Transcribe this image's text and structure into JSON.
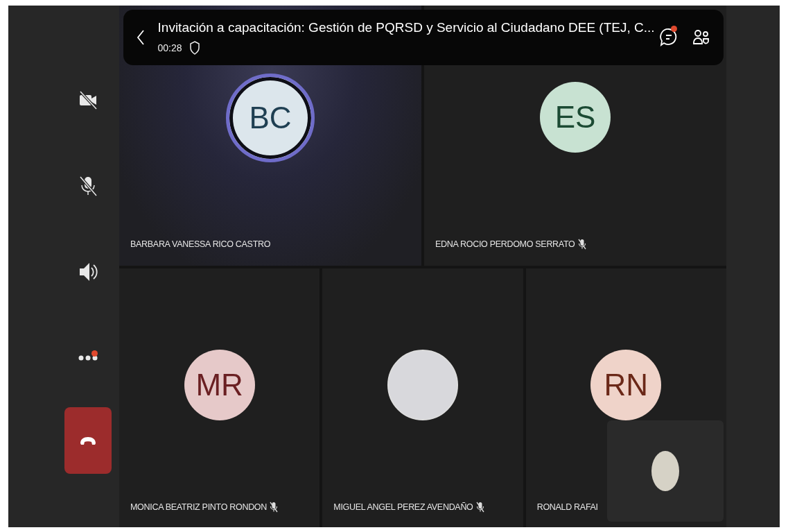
{
  "meeting": {
    "title": "Invitación a capacitación: Gestión de PQRSD y Servicio al Ciudadano DEE (TEJ, C...",
    "elapsed": "00:28",
    "chat_notification": true
  },
  "controls": [
    {
      "kind": "camera_off",
      "notification": false
    },
    {
      "kind": "mic_off",
      "notification": false
    },
    {
      "kind": "speaker",
      "notification": false
    },
    {
      "kind": "more",
      "notification": true
    },
    {
      "kind": "hang_up",
      "notification": false
    }
  ],
  "participants": [
    {
      "name": "BARBARA VANESSA RICO CASTRO",
      "kind": "initials",
      "initials": "BC",
      "color": "#dce6ec",
      "muted": false,
      "speaking": true
    },
    {
      "name": "EDNA ROCIO PERDOMO SERRATO",
      "kind": "initials",
      "initials": "ES",
      "color": "#c8e2d2",
      "muted": true,
      "speaking": false
    },
    {
      "name": "MONICA BEATRIZ PINTO RONDON",
      "kind": "initials",
      "initials": "MR",
      "color": "#e6c9c9",
      "muted": true,
      "speaking": false
    },
    {
      "name": "MIGUEL ANGEL PEREZ AVENDAÑO",
      "kind": "photo",
      "muted": true,
      "speaking": false
    },
    {
      "name": "RONALD RAFAI",
      "kind": "initials",
      "initials": "RN",
      "color": "#efd3c9",
      "muted": false,
      "speaking": false
    }
  ],
  "self_view": {
    "kind": "photo"
  }
}
